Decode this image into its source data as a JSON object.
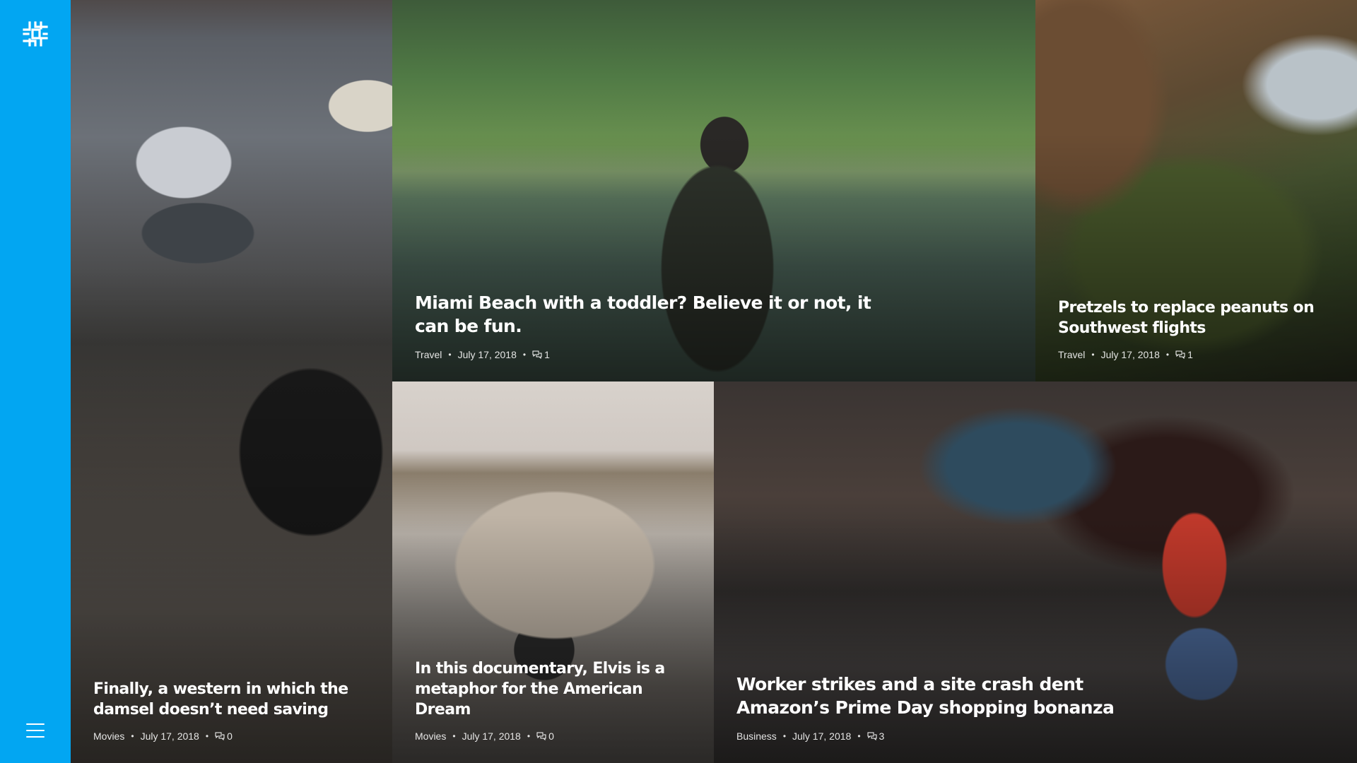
{
  "sidebar": {
    "logo_icon": "grid-hash-logo-icon",
    "menu_icon": "hamburger-menu-icon",
    "color": "#02a6f2"
  },
  "posts": [
    {
      "title": "Finally, a western in which the damsel doesn’t need saving",
      "category": "Movies",
      "date": "July 17, 2018",
      "comments": "0"
    },
    {
      "title": "Miami Beach with a toddler? Believe it or not, it can be fun.",
      "category": "Travel",
      "date": "July 17, 2018",
      "comments": "1"
    },
    {
      "title": "Pretzels to replace peanuts on Southwest flights",
      "category": "Travel",
      "date": "July 17, 2018",
      "comments": "1"
    },
    {
      "title": "In this documentary, Elvis is a metaphor for the American Dream",
      "category": "Movies",
      "date": "July 17, 2018",
      "comments": "0"
    },
    {
      "title": "Worker strikes and a site crash dent Amazon’s Prime Day shopping bonanza",
      "category": "Business",
      "date": "July 17, 2018",
      "comments": "3"
    }
  ],
  "separator": "•"
}
